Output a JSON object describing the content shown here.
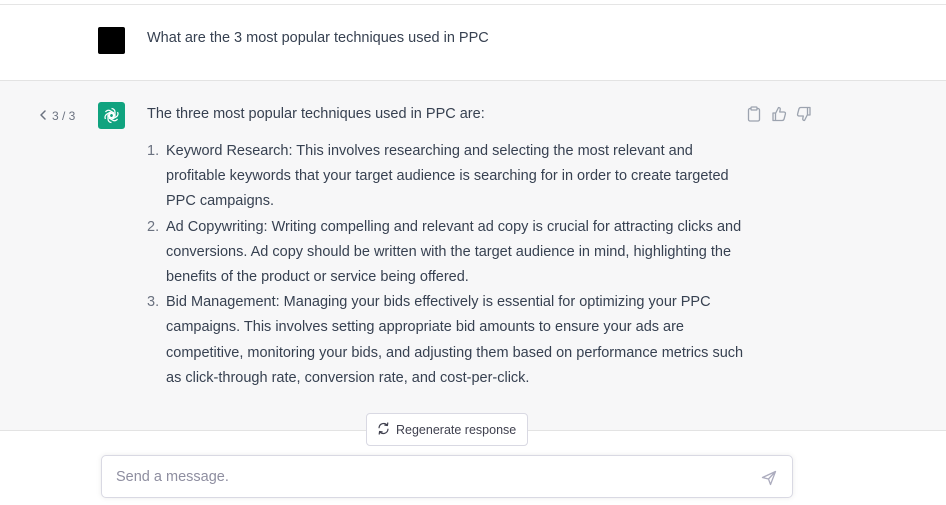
{
  "user_message": {
    "text": "What are the 3 most popular techniques used in PPC"
  },
  "assistant_message": {
    "pager": {
      "prev_icon": "chevron-left-icon",
      "label": "3 / 3"
    },
    "intro": "The three most popular techniques used in PPC are:",
    "items": [
      {
        "number": "1.",
        "text": "Keyword Research: This involves researching and selecting the most relevant and profitable keywords that your target audience is searching for in order to create targeted PPC campaigns."
      },
      {
        "number": "2.",
        "text": "Ad Copywriting: Writing compelling and relevant ad copy is crucial for attracting clicks and conversions. Ad copy should be written with the target audience in mind, highlighting the benefits of the product or service being offered."
      },
      {
        "number": "3.",
        "text": "Bid Management: Managing your bids effectively is essential for optimizing your PPC campaigns. This involves setting appropriate bid amounts to ensure your ads are competitive, monitoring your bids, and adjusting them based on performance metrics such as click-through rate, conversion rate, and cost-per-click."
      }
    ],
    "actions": [
      "clipboard-icon",
      "thumbs-up-icon",
      "thumbs-down-icon"
    ]
  },
  "regenerate": {
    "label": "Regenerate response",
    "icon": "refresh-icon"
  },
  "composer": {
    "placeholder": "Send a message.",
    "value": "",
    "send_icon": "send-icon"
  },
  "colors": {
    "assistant_avatar": "#10a37f",
    "user_avatar": "#000000",
    "assistant_bg": "#f7f7f8",
    "text": "#374151",
    "muted": "#6b7280"
  }
}
